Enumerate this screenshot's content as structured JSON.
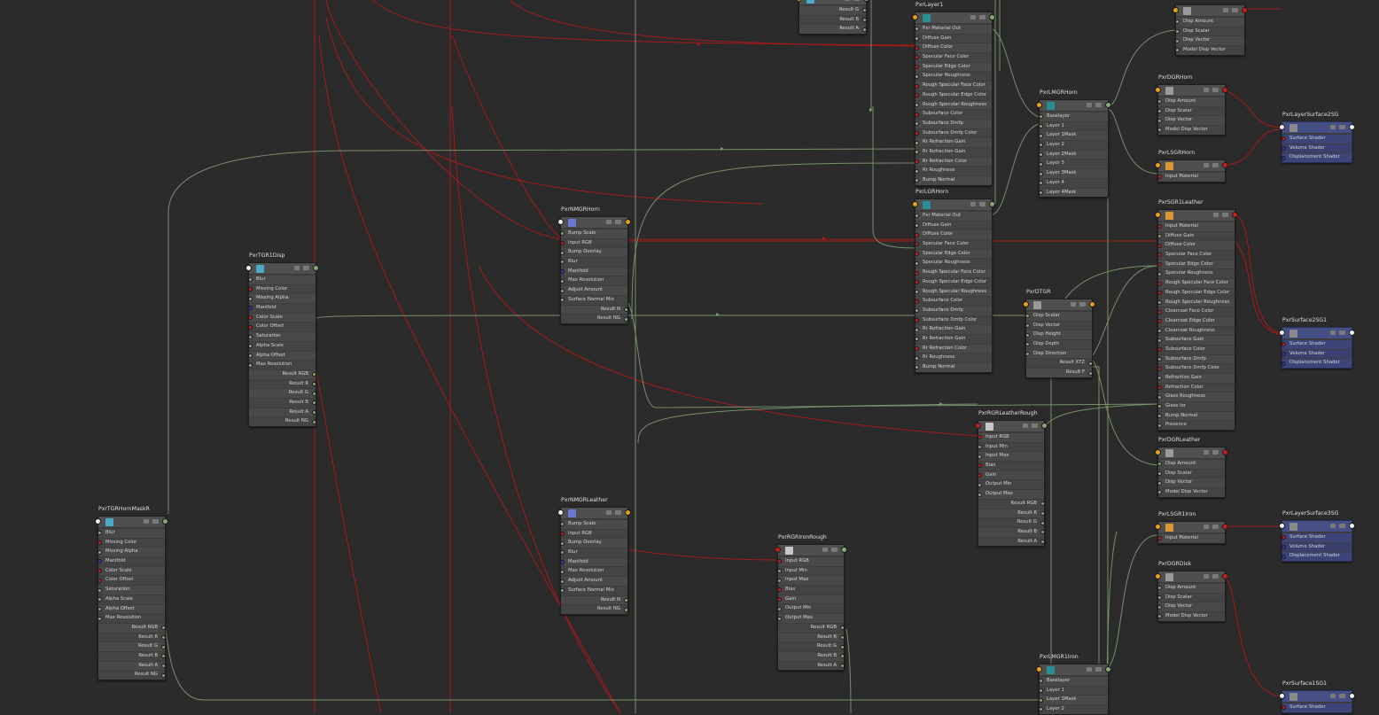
{
  "colors": {
    "background": "#2b2b2b",
    "node_body": "#494949",
    "shading_group": "#3c4478",
    "connection_red": "#b01818",
    "connection_green": "#7e9a72",
    "pin_float": "#8aa77a",
    "pin_color": "#c02020",
    "pin_vector": "#2a3aa8",
    "pin_output_header": "#e6a020"
  },
  "nodes": [
    {
      "id": "pxrlayer1",
      "title": "PxrLayer1",
      "icon": "layer-icon",
      "attrs": [
        "Pxr Material Out",
        "Diffuse Gain",
        "Diffuse Color",
        "Specular Face Color",
        "Specular Edge Color",
        "Specular Roughness",
        "Rough Specular Face Color",
        "Rough Specular Edge Color",
        "Rough Specular Roughness",
        "Subsurface Color",
        "Subsurface Dmfp",
        "Subsurface Dmfp Color",
        "Rr Refraction Gain",
        "Rr Refraction Gain",
        "Rr Refraction Color",
        "Rr Roughness",
        "Bump Normal"
      ]
    },
    {
      "id": "pxrlgrhorn",
      "title": "PxrLGRHorn",
      "icon": "layer-icon",
      "attrs": [
        "Pxr Material Out",
        "Diffuse Gain",
        "Diffuse Color",
        "Specular Face Color",
        "Specular Edge Color",
        "Specular Roughness",
        "Rough Specular Face Color",
        "Rough Specular Edge Color",
        "Rough Specular Roughness",
        "Subsurface Color",
        "Subsurface Dmfp",
        "Subsurface Dmfp Color",
        "Rr Refraction Gain",
        "Rr Refraction Gain",
        "Rr Refraction Color",
        "Rr Roughness",
        "Bump Normal"
      ]
    },
    {
      "id": "pxrlmgrhorn",
      "title": "PxrLMGRHorn",
      "icon": "layer-mixer-icon",
      "attrs": [
        "Baselayer",
        "Layer 1",
        "Layer 1Mask",
        "Layer 2",
        "Layer 2Mask",
        "Layer 3",
        "Layer 3Mask",
        "Layer 4",
        "Layer 4Mask"
      ]
    },
    {
      "id": "pxrlmgr1iron",
      "title": "PxrLMGR1Iron",
      "icon": "layer-mixer-icon",
      "attrs": [
        "Baselayer",
        "Layer 1",
        "Layer 1Mask",
        "Layer 2"
      ]
    },
    {
      "id": "pxrdisp_top",
      "title": "",
      "icon": "displace-icon",
      "attrs": [
        "Disp Amount",
        "Disp Scalar",
        "Disp Vector",
        "Model Disp Vector"
      ]
    },
    {
      "id": "pxrdgrhorn",
      "title": "PxrDGRHorn",
      "icon": "displace-icon",
      "attrs": [
        "Disp Amount",
        "Disp Scalar",
        "Disp Vector",
        "Model Disp Vector"
      ]
    },
    {
      "id": "pxrlsgrhorn",
      "title": "PxrLSGRHorn",
      "icon": "layer-surface-icon",
      "attrs": [
        "Input Material"
      ]
    },
    {
      "id": "pxrsgr1leather",
      "title": "PxrSGR1Leather",
      "icon": "surface-icon",
      "attrs": [
        "Input Material",
        "Diffuse Gain",
        "Diffuse Color",
        "Specular Face Color",
        "Specular Edge Color",
        "Specular Roughness",
        "Rough Specular Face Color",
        "Rough Specular Edge Color",
        "Rough Specular Roughness",
        "Clearcoat Face Color",
        "Clearcoat Edge Color",
        "Clearcoat Roughness",
        "Subsurface Gain",
        "Subsurface Color",
        "Subsurface Dmfp",
        "Subsurface Dmfp Color",
        "Refraction Gain",
        "Refraction Color",
        "Glass Roughness",
        "Glass Ior",
        "Bump Normal",
        "Presence"
      ]
    },
    {
      "id": "pxrdgrleather",
      "title": "PxrDGRLeather",
      "icon": "displace-icon",
      "attrs": [
        "Disp Amount",
        "Disp Scalar",
        "Disp Vector",
        "Model Disp Vector"
      ]
    },
    {
      "id": "pxrlsgr1iron",
      "title": "PxrLSGR1Iron",
      "icon": "layer-surface-icon",
      "attrs": [
        "Input Material"
      ]
    },
    {
      "id": "pxrdgrdisk",
      "title": "PxrDGRDisk",
      "icon": "displace-icon",
      "attrs": [
        "Disp Amount",
        "Disp Scalar",
        "Disp Vector",
        "Model Disp Vector"
      ]
    },
    {
      "id": "pxrdtgr",
      "title": "PxrDTGR",
      "icon": "disp-transform-icon",
      "attrs": [
        "Disp Scalar",
        "Disp Vector",
        "Disp Height",
        "Disp Depth",
        "Disp Direction"
      ],
      "outputs": [
        "Result XYZ",
        "Result F"
      ]
    },
    {
      "id": "pxrrgrleatherrough",
      "title": "PxrRGRLeatherRough",
      "icon": "remap-icon",
      "attrs": [
        "Input RGB",
        "Input Min",
        "Input Max",
        "Bias",
        "Gain",
        "Output Min",
        "Output Max"
      ],
      "outputs": [
        "Result RGB",
        "Result R",
        "Result G",
        "Result B",
        "Result A"
      ]
    },
    {
      "id": "pxrrgrironrough",
      "title": "PxrRGRIronRough",
      "icon": "remap-icon",
      "attrs": [
        "Input RGB",
        "Input Min",
        "Input Max",
        "Bias",
        "Gain",
        "Output Min",
        "Output Max"
      ],
      "outputs": [
        "Result RGB",
        "Result R",
        "Result G",
        "Result B",
        "Result A"
      ]
    },
    {
      "id": "pxrnmgrhorn",
      "title": "PxrNMGRHorn",
      "icon": "normal-map-icon",
      "attrs": [
        "Bump Scale",
        "Input RGB",
        "Bump Overlay",
        "Blur",
        "Manifold",
        "Max Resolution",
        "Adjust Amount",
        "Surface Normal Mix"
      ],
      "outputs": [
        "Result N",
        "Result NG"
      ]
    },
    {
      "id": "pxrnmgrleather",
      "title": "PxrNMGRLeather",
      "icon": "normal-map-icon",
      "attrs": [
        "Bump Scale",
        "Input RGB",
        "Bump Overlay",
        "Blur",
        "Manifold",
        "Max Resolution",
        "Adjust Amount",
        "Surface Normal Mix"
      ],
      "outputs": [
        "Result N",
        "Result NG"
      ]
    },
    {
      "id": "pxrtgr1disp",
      "title": "PxrTGR1Disp",
      "icon": "texture-icon",
      "attrs": [
        "Blur",
        "Missing Color",
        "Missing Alpha",
        "Manifold",
        "Color Scale",
        "Color Offset",
        "Saturation",
        "Alpha Scale",
        "Alpha Offset",
        "Max Resolution"
      ],
      "outputs": [
        "Result RGB",
        "Result R",
        "Result G",
        "Result B",
        "Result A",
        "Result NG"
      ]
    },
    {
      "id": "pxrtgrhornmaskr",
      "title": "PxrTGRHornMaskR",
      "icon": "texture-icon",
      "attrs": [
        "Blur",
        "Missing Color",
        "Missing Alpha",
        "Manifold",
        "Color Scale",
        "Color Offset",
        "Saturation",
        "Alpha Scale",
        "Alpha Offset",
        "Max Resolution"
      ],
      "outputs": [
        "Result RGB",
        "Result R",
        "Result G",
        "Result B",
        "Result A",
        "Result NG"
      ]
    },
    {
      "id": "pxrtex_top",
      "title": "",
      "icon": "texture-icon",
      "attrs": [],
      "outputs": [
        "Result G",
        "Result B",
        "Result A"
      ]
    },
    {
      "id": "pxrlayersurface2sg",
      "title": "PxrLayerSurface2SG",
      "icon": "shading-group-icon",
      "attrs": [
        "Surface Shader",
        "Volume Shader",
        "Displacement Shader"
      ]
    },
    {
      "id": "pxrsurface2sg1",
      "title": "PxrSurface2SG1",
      "icon": "shading-group-icon",
      "attrs": [
        "Surface Shader",
        "Volume Shader",
        "Displacement Shader"
      ]
    },
    {
      "id": "pxrlayersurface3sg",
      "title": "PxrLayerSurface3SG",
      "icon": "shading-group-icon",
      "attrs": [
        "Surface Shader",
        "Volume Shader",
        "Displacement Shader"
      ]
    },
    {
      "id": "pxrsurface1sg1",
      "title": "PxrSurface1SG1",
      "icon": "shading-group-icon",
      "attrs": [
        "Surface Shader"
      ]
    }
  ]
}
